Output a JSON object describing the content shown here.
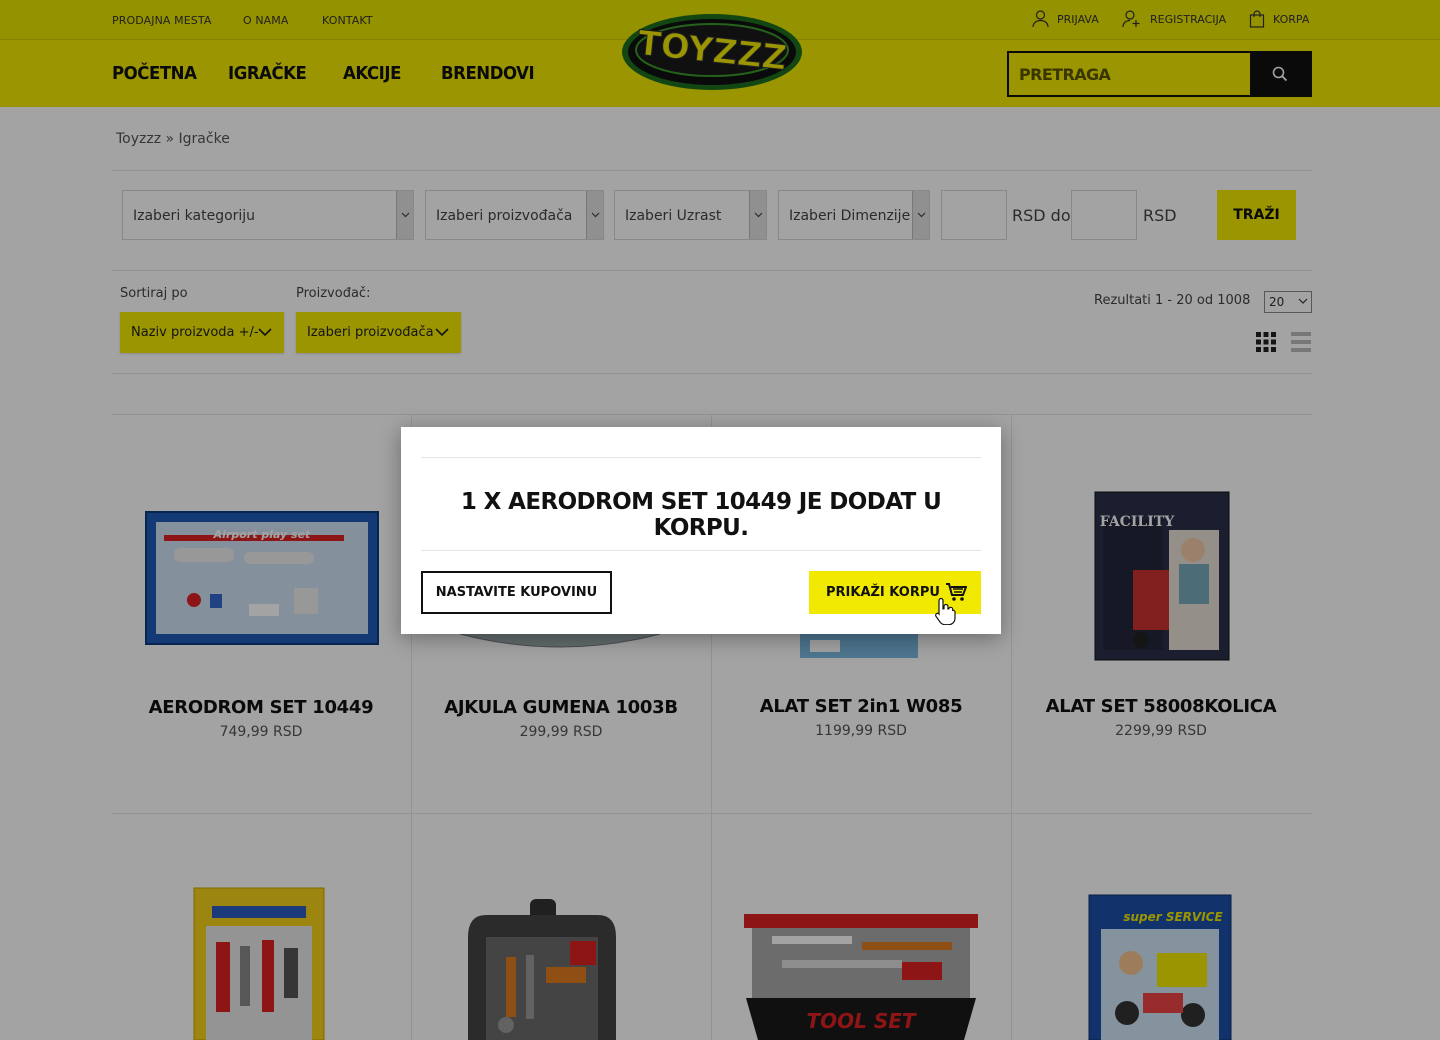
{
  "header": {
    "top_links": [
      "PRODAJNA MESTA",
      "O NAMA",
      "KONTAKT"
    ],
    "account": {
      "login": "PRIJAVA",
      "register": "REGISTRACIJA",
      "cart": "KORPA"
    },
    "nav": [
      "POČETNA",
      "IGRAČKE",
      "AKCIJE",
      "BRENDOVI"
    ],
    "logo_text": "TOYZZZ",
    "search_placeholder": "PRETRAGA"
  },
  "breadcrumb": "Toyzzz » Igračke",
  "filters": {
    "category": "Izaberi kategoriju",
    "manufacturer": "Izaberi proizvođača",
    "age": "Izaberi Uzrast",
    "dimensions": "Izaberi Dimenzije",
    "price_from_unit": "RSD do",
    "price_to_unit": "RSD",
    "search_button": "TRAŽI"
  },
  "sorting": {
    "sort_label": "Sortiraj po",
    "sort_value": "Naziv proizvoda +/-",
    "manufacturer_label": "Proizvođač:",
    "manufacturer_value": "Izaberi proizvođača",
    "results": "Rezultati 1 - 20 od 1008",
    "per_page": "20"
  },
  "products": [
    {
      "name": "AERODROM SET 10449",
      "price": "749,99 RSD"
    },
    {
      "name": "AJKULA GUMENA 1003B",
      "price": "299,99 RSD"
    },
    {
      "name": "ALAT SET 2in1 W085",
      "price": "1199,99 RSD"
    },
    {
      "name": "ALAT SET 58008KOLICA",
      "price": "2299,99 RSD"
    }
  ],
  "modal": {
    "message": "1 X AERODROM SET 10449 JE DODAT U KORPU.",
    "continue_button": "NASTAVITE KUPOVINU",
    "cart_button": "PRIKAŽI KORPU"
  },
  "colors": {
    "brand_yellow": "#f1ea00",
    "dark": "#111111"
  }
}
